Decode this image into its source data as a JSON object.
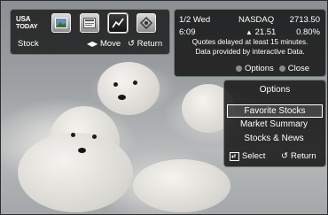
{
  "topbar": {
    "logo_line1": "USA",
    "logo_line2": "TODAY",
    "icons": [
      "photo-icon",
      "news-icon",
      "stock-chart-icon",
      "settings-icon"
    ],
    "label": "Stock",
    "move_label": "Move",
    "return_label": "Return"
  },
  "quote": {
    "date": "1/2 Wed",
    "exchange": "NASDAQ",
    "value": "2713.50",
    "time": "6:09",
    "change": "21.51",
    "percent": "0.80%",
    "notice_line1": "Quotes delayed at least 15 minutes.",
    "notice_line2": "Data provided by interactive Data.",
    "options_label": "Options",
    "close_label": "Close"
  },
  "menu": {
    "title": "Options",
    "items": [
      "Favorite Stocks",
      "Market Summary",
      "Stocks & News"
    ],
    "selected_index": 0,
    "select_label": "Select",
    "return_label": "Return"
  },
  "colors": {
    "panel_bg": "#141414",
    "text": "#ffffff",
    "dot": "#8c8c8c"
  }
}
